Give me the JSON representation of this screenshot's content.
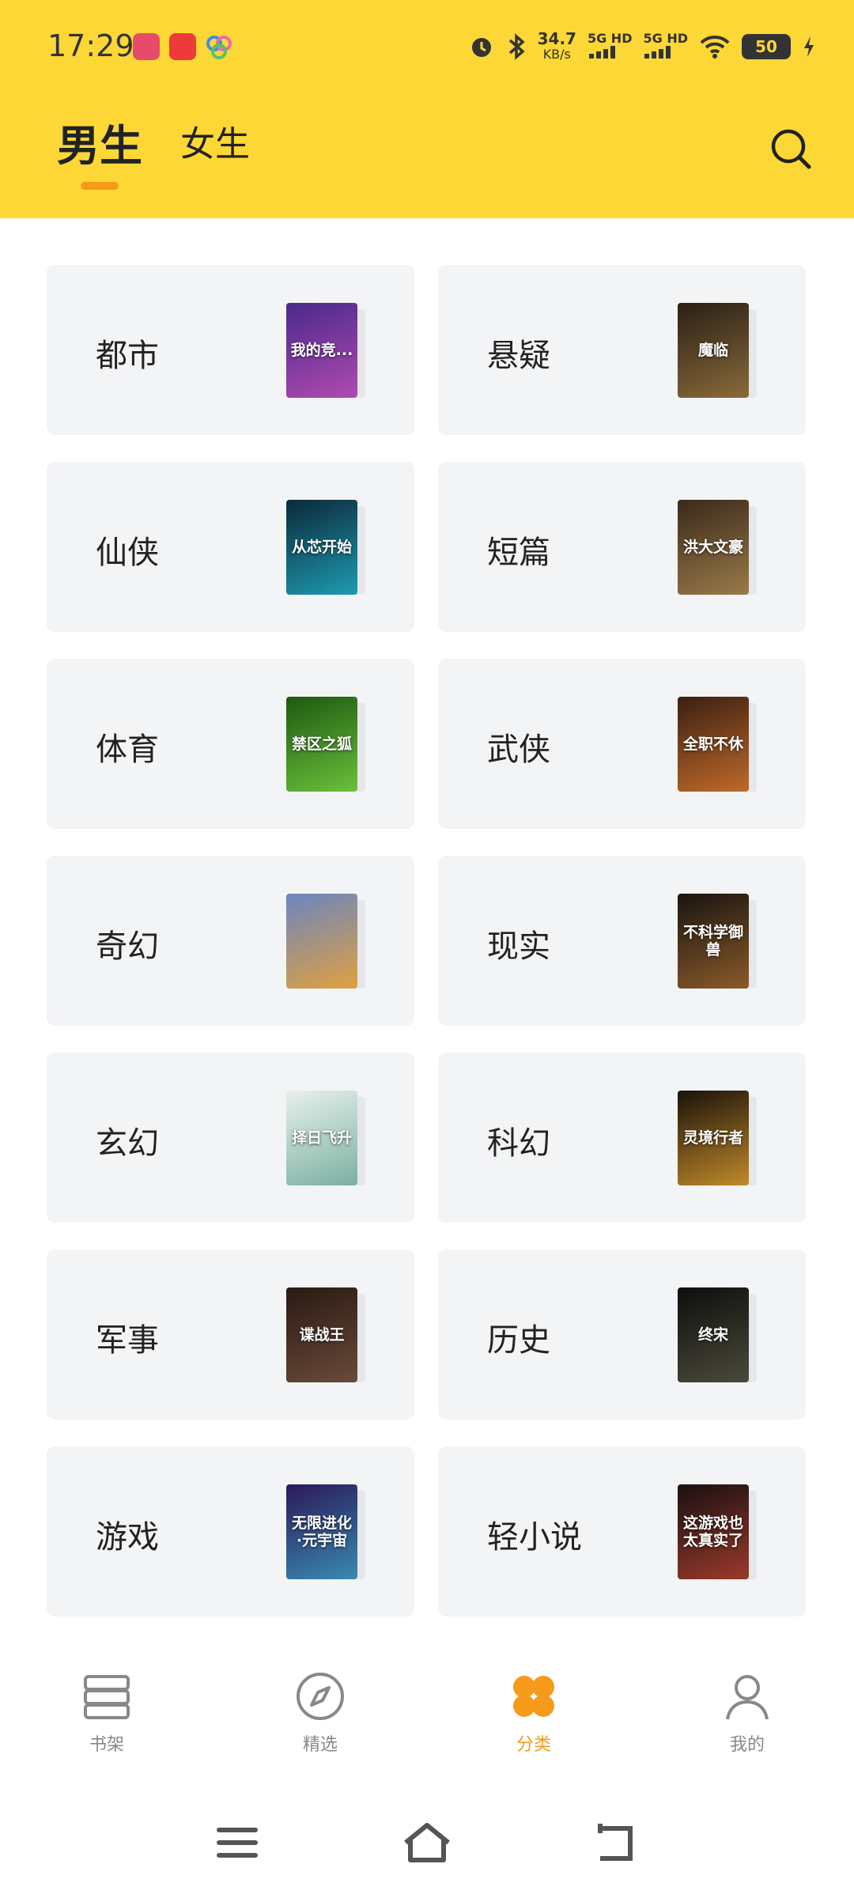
{
  "status_bar": {
    "time": "17:29",
    "net_speed_value": "34.7",
    "net_speed_unit": "KB/s",
    "sim1": "5G HD",
    "sim2": "5G HD",
    "battery": "50"
  },
  "header": {
    "tabs": [
      {
        "label": "男生",
        "active": true
      },
      {
        "label": "女生",
        "active": false
      }
    ],
    "accent_color": "#fdd736",
    "indicator_color": "#f59a1a"
  },
  "categories": [
    {
      "label": "都市",
      "cover_text": "我的竞...",
      "cover_colors": [
        "#4a2a8c",
        "#b04ab0"
      ]
    },
    {
      "label": "悬疑",
      "cover_text": "魔临",
      "cover_colors": [
        "#2a2016",
        "#8a6a3a"
      ]
    },
    {
      "label": "仙侠",
      "cover_text": "从芯开始",
      "cover_colors": [
        "#0b2a3a",
        "#1e9ab0"
      ]
    },
    {
      "label": "短篇",
      "cover_text": "洪大文豪",
      "cover_colors": [
        "#3a2a1a",
        "#9a7a4a"
      ]
    },
    {
      "label": "体育",
      "cover_text": "禁区之狐",
      "cover_colors": [
        "#1e5a12",
        "#6ac03a"
      ]
    },
    {
      "label": "武侠",
      "cover_text": "全职不休",
      "cover_colors": [
        "#3a2012",
        "#c06a2a"
      ]
    },
    {
      "label": "奇幻",
      "cover_text": "",
      "cover_colors": [
        "#6a86c0",
        "#e0a040"
      ]
    },
    {
      "label": "现实",
      "cover_text": "不科学御兽",
      "cover_colors": [
        "#1a1410",
        "#8a5a2a"
      ]
    },
    {
      "label": "玄幻",
      "cover_text": "择日飞升",
      "cover_colors": [
        "#e8f0ee",
        "#7ab0a0"
      ]
    },
    {
      "label": "科幻",
      "cover_text": "灵境行者",
      "cover_colors": [
        "#1a120a",
        "#c08a2a"
      ]
    },
    {
      "label": "军事",
      "cover_text": "谍战王",
      "cover_colors": [
        "#2a1a14",
        "#6a4a3a"
      ]
    },
    {
      "label": "历史",
      "cover_text": "终宋",
      "cover_colors": [
        "#0e0e0e",
        "#4a4a3a"
      ]
    },
    {
      "label": "游戏",
      "cover_text": "无限进化·元宇宙",
      "cover_colors": [
        "#2a1a5a",
        "#3a8ab0"
      ]
    },
    {
      "label": "轻小说",
      "cover_text": "这游戏也太真实了",
      "cover_colors": [
        "#1a1012",
        "#9a3a2a"
      ]
    }
  ],
  "bottom_nav": [
    {
      "label": "书架",
      "icon": "bookshelf-icon",
      "active": false
    },
    {
      "label": "精选",
      "icon": "compass-icon",
      "active": false
    },
    {
      "label": "分类",
      "icon": "category-icon",
      "active": true
    },
    {
      "label": "我的",
      "icon": "user-icon",
      "active": false
    }
  ]
}
